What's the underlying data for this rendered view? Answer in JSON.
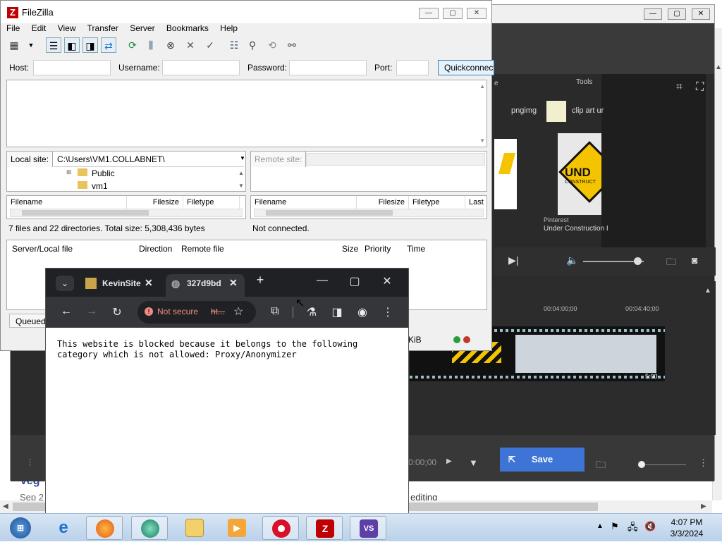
{
  "background_page": {
    "partial_heading": "Veg",
    "partial_date": "Sep 2",
    "partial_text": "editing"
  },
  "editor": {
    "preview_item1": "pngimg",
    "preview_item2": "clip art ur",
    "preview_tools": "Tools",
    "preview_source": "Pinterest",
    "preview_caption": "Under Construction I",
    "preview_sign_text": "UND",
    "preview_sign_sub": "CONSTRUCT",
    "timeline_mark1": "00:04:00;00",
    "timeline_mark2": "00:04:40;00",
    "strip_end": "5:00",
    "timecode": "0:00;00",
    "save_label": "Save",
    "prev_edge": "e"
  },
  "filezilla": {
    "title": "FileZilla",
    "menu": [
      "File",
      "Edit",
      "View",
      "Transfer",
      "Server",
      "Bookmarks",
      "Help"
    ],
    "host_label": "Host:",
    "username_label": "Username:",
    "password_label": "Password:",
    "port_label": "Port:",
    "quickconnect_label": "Quickconnect",
    "local_site_label": "Local site:",
    "local_site_path": "C:\\Users\\VM1.COLLABNET\\",
    "remote_site_label": "Remote site:",
    "tree_items": [
      "Public",
      "vm1"
    ],
    "local_columns": [
      "Filename",
      "Filesize",
      "Filetype"
    ],
    "remote_columns": [
      "Filename",
      "Filesize",
      "Filetype",
      "Last"
    ],
    "local_status": "7 files and 22 directories. Total size: 5,308,436 bytes",
    "remote_status": "Not connected.",
    "queue_columns": [
      "Server/Local file",
      "Direction",
      "Remote file",
      "Size",
      "Priority",
      "Time"
    ],
    "queue_tab": "Queued",
    "bottom_status": "KiB"
  },
  "chrome": {
    "tab1_title": "KevinSite",
    "tab2_title": "327d9bd",
    "not_secure": "Not secure",
    "url_fragment": "ht...",
    "page_message": "This website is blocked because it belongs to the following category which is not allowed: Proxy/Anonymizer"
  },
  "taskbar": {
    "apps": [
      "start-button",
      "internet-explorer",
      "firefox",
      "app-green",
      "explorer",
      "media-player",
      "recorder",
      "filezilla",
      "visual-studio"
    ],
    "clock_time": "4:07 PM",
    "clock_date": "3/3/2024"
  }
}
